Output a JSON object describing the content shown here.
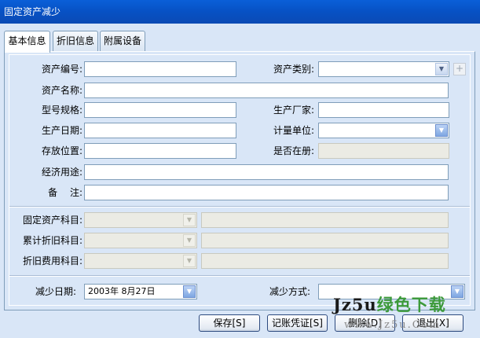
{
  "window": {
    "title": "固定资产减少"
  },
  "tabs": [
    {
      "label": "基本信息",
      "active": true
    },
    {
      "label": "折旧信息",
      "active": false
    },
    {
      "label": "附属设备",
      "active": false
    }
  ],
  "form": {
    "asset_code_label": "资产编号:",
    "asset_category_label": "资产类别:",
    "asset_name_label": "资产名称:",
    "model_spec_label": "型号规格:",
    "manufacturer_label": "生产厂家:",
    "production_date_label": "生产日期:",
    "unit_label": "计量单位:",
    "location_label": "存放位置:",
    "registered_label": "是否在册:",
    "economic_use_label": "经济用途:",
    "remark_label": "备　 注:",
    "asset_account_label": "固定资产科目:",
    "depr_account_label": "累计折旧科目:",
    "depr_expense_label": "折旧费用科目:",
    "reduce_date_label": "减少日期:",
    "reduce_date_value": "2003年  8月27日",
    "reduce_method_label": "减少方式:"
  },
  "icons": {
    "dropdown": "▼",
    "add": "+"
  },
  "buttons": {
    "save": "保存[S]",
    "voucher": "记账凭证[S]",
    "delete": "删除[D]",
    "exit": "退出[X]"
  },
  "watermark": {
    "brand": "Jz5u",
    "main": "绿色下载",
    "sub": "www.Jz5u.Com"
  }
}
